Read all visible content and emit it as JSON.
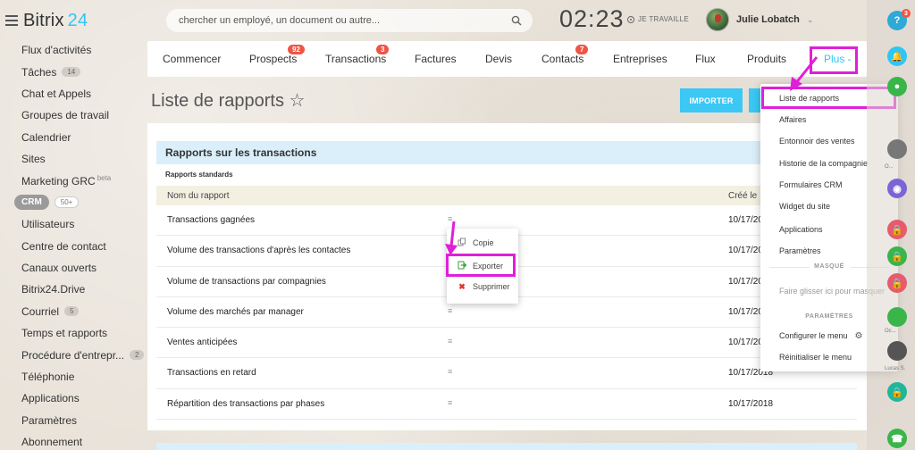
{
  "header": {
    "logo_brand": "Bitrix",
    "logo_number": "24",
    "search_placeholder": "chercher un employé, un document ou autre...",
    "clock": "02:23",
    "work_status": "JE TRAVAILLE",
    "user_name": "Julie Lobatch"
  },
  "sidebar": {
    "items": [
      {
        "label": "Flux d'activités"
      },
      {
        "label": "Tâches",
        "count": "14"
      },
      {
        "label": "Chat et Appels"
      },
      {
        "label": "Groupes de travail"
      },
      {
        "label": "Calendrier"
      },
      {
        "label": "Sites"
      },
      {
        "label": "Marketing GRC",
        "beta": "beta"
      },
      {
        "label": "CRM",
        "count": "50+"
      },
      {
        "label": "Utilisateurs"
      },
      {
        "label": "Centre de contact"
      },
      {
        "label": "Canaux ouverts"
      },
      {
        "label": "Bitrix24.Drive"
      },
      {
        "label": "Courriel",
        "count": "5"
      },
      {
        "label": "Temps et rapports"
      },
      {
        "label": "Procédure d'entrepr...",
        "count": "2"
      },
      {
        "label": "Téléphonie"
      },
      {
        "label": "Applications"
      },
      {
        "label": "Paramètres"
      },
      {
        "label": "Abonnement"
      }
    ]
  },
  "topnav": {
    "items": [
      {
        "label": "Commencer"
      },
      {
        "label": "Prospects",
        "badge": "92"
      },
      {
        "label": "Transactions",
        "badge": "3"
      },
      {
        "label": "Factures"
      },
      {
        "label": "Devis"
      },
      {
        "label": "Contacts",
        "badge": "7"
      },
      {
        "label": "Entreprises"
      },
      {
        "label": "Flux"
      },
      {
        "label": "Produits"
      },
      {
        "label": "Plus -"
      }
    ]
  },
  "page": {
    "title": "Liste de rapports ☆",
    "import_button": "IMPORTER"
  },
  "report": {
    "section_title": "Rapports sur les transactions",
    "subsection": "Rapports standards",
    "columns": {
      "name": "Nom du rapport",
      "created": "Créé le"
    },
    "rows": [
      {
        "name": "Transactions gagnées",
        "date": "10/17/20"
      },
      {
        "name": "Volume des transactions d'après les contactes",
        "date": "10/17/20"
      },
      {
        "name": "Volume de transactions par compagnies",
        "date": "10/17/20"
      },
      {
        "name": "Volume des marchés par manager",
        "date": "10/17/20"
      },
      {
        "name": "Ventes anticipées",
        "date": "10/17/20"
      },
      {
        "name": "Transactions en retard",
        "date": "10/17/2018"
      },
      {
        "name": "Répartition des transactions par phases",
        "date": "10/17/2018"
      }
    ],
    "row_menu_icon": "≡"
  },
  "context_menu": {
    "items": [
      {
        "label": "Copie",
        "icon": "copy-icon"
      },
      {
        "label": "Exporter",
        "icon": "export-icon"
      },
      {
        "label": "Supprimer",
        "icon": "delete-icon"
      }
    ]
  },
  "dropdown": {
    "items": [
      "Liste de rapports",
      "Affaires",
      "Entonnoir des ventes",
      "Historie de la compagnie",
      "Formulaires CRM",
      "Widget du site",
      "Applications",
      "Paramètres"
    ],
    "hidden_label": "MASQUÉ",
    "hidden_hint": "Faire glisser ici pour masquer",
    "settings_label": "PARAMÈTRES",
    "configure": "Configurer le menu",
    "reset": "Réinitialiser le menu"
  },
  "right_rail": {
    "help_badge": "3",
    "labels": [
      "O...",
      "Oc...",
      "Lucas S."
    ]
  },
  "colors": {
    "accent": "#2fc6f6",
    "highlight": "#e01fd8",
    "badge": "#ef5545"
  }
}
